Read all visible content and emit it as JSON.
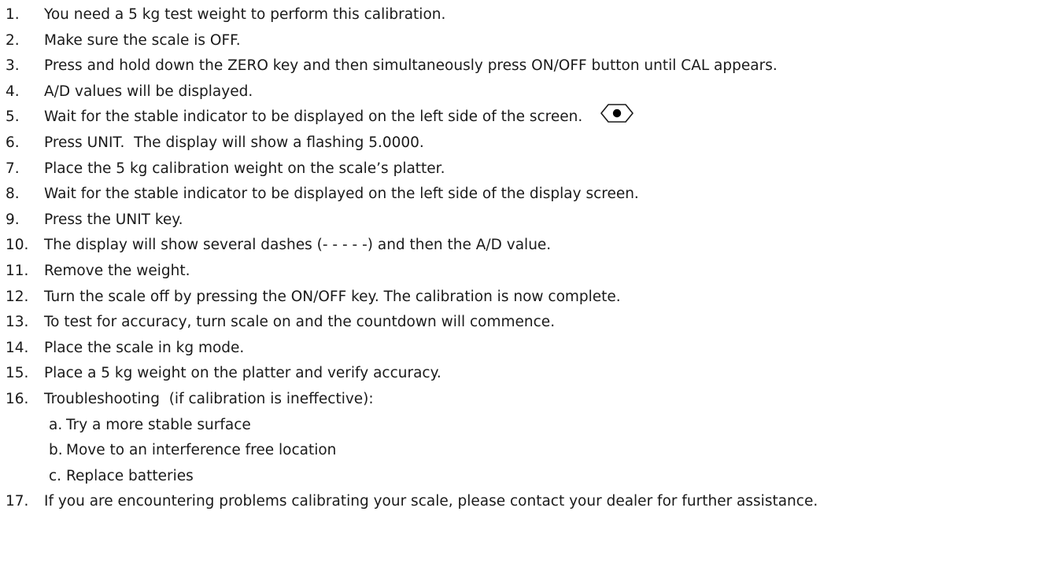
{
  "steps": [
    {
      "num": "1.",
      "text": "You need a 5 kg test weight to perform this calibration."
    },
    {
      "num": "2.",
      "text": "Make sure the scale is OFF."
    },
    {
      "num": "3.",
      "text": "Press and hold down the ZERO key and then simultaneously press ON/OFF button until CAL appears."
    },
    {
      "num": "4.",
      "text": "A/D values will be displayed."
    },
    {
      "num": "5.",
      "text": "Wait for the stable indicator to be displayed on the left side of the screen.",
      "icon": "stable-indicator-icon"
    },
    {
      "num": "6.",
      "text": "Press UNIT.  The display will show a flashing 5.0000."
    },
    {
      "num": "7.",
      "text": "Place the 5 kg calibration weight on the scale’s platter."
    },
    {
      "num": "8.",
      "text": "Wait for the stable indicator to be displayed on the left side of the display screen."
    },
    {
      "num": "9.",
      "text": "Press the UNIT key."
    },
    {
      "num": "10.",
      "text": "The display will show several dashes (- - - - -) and then the A/D value."
    },
    {
      "num": "11.",
      "text": "Remove the weight."
    },
    {
      "num": "12.",
      "text": "Turn the scale off by pressing the ON/OFF key. The calibration is now complete."
    },
    {
      "num": "13.",
      "text": "To test for accuracy, turn scale on and the countdown will commence."
    },
    {
      "num": "14.",
      "text": "Place the scale in kg mode."
    },
    {
      "num": "15.",
      "text": "Place a 5 kg weight on the platter and verify accuracy."
    },
    {
      "num": "16.",
      "text": "Troubleshooting  (if calibration is ineffective):"
    }
  ],
  "substeps": [
    {
      "letter": "a.",
      "text": "Try a more stable surface"
    },
    {
      "letter": "b.",
      "text": "Move to an interference free location"
    },
    {
      "letter": "c.",
      "text": "Replace batteries"
    }
  ],
  "final_step": {
    "num": "17.",
    "text": "If you are encountering problems calibrating your scale, please contact your dealer for further assistance."
  }
}
